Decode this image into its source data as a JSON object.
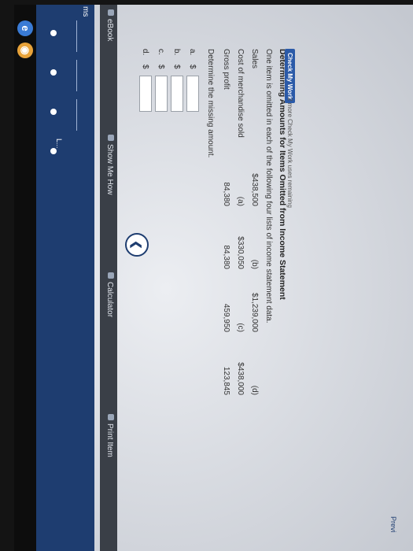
{
  "nav": {
    "rail_label": "ms",
    "rail_sub": "L..."
  },
  "toolbar": {
    "ebook": "eBook",
    "show_me_how": "Show Me How",
    "calculator": "Calculator",
    "print_item": "Print Item"
  },
  "problem": {
    "title": "Determining Amounts for Items Omitted from Income Statement",
    "instructions": "One item is omitted in each of the following four lists of income statement data.",
    "rows": [
      {
        "label": "Sales",
        "values": [
          "$438,500",
          "(b)",
          "$1,239,000",
          "(d)"
        ]
      },
      {
        "label": "Cost of merchandise sold",
        "values": [
          "(a)",
          "$330,050",
          "(c)",
          "$438,000"
        ]
      },
      {
        "label": "Gross profit",
        "values": [
          "84,380",
          "84,380",
          "459,950",
          "123,845"
        ]
      }
    ],
    "prompt": "Determine the missing amount.",
    "answers": [
      {
        "letter": "a.",
        "currency": "$",
        "value": ""
      },
      {
        "letter": "b.",
        "currency": "$",
        "value": ""
      },
      {
        "letter": "c.",
        "currency": "$",
        "value": ""
      },
      {
        "letter": "d.",
        "currency": "$",
        "value": ""
      }
    ]
  },
  "footer": {
    "check_label": "Check My Work",
    "check_note": "2 more Check My Work uses remaining",
    "prev_label": "Previ"
  },
  "colors": {
    "sidebar": "#1e3d70",
    "check_button": "#2b5aa8"
  }
}
